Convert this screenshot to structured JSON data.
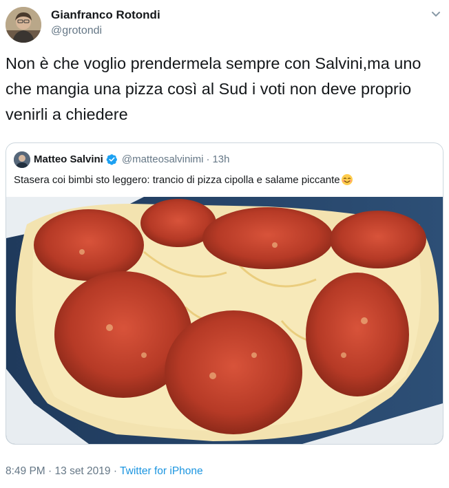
{
  "author": {
    "name": "Gianfranco Rotondi",
    "handle": "@grotondi"
  },
  "tweet": {
    "text": "Non è che voglio prendermela sempre con Salvini,ma uno che mangia una pizza così al Sud i voti non deve proprio venirli a chiedere"
  },
  "quoted": {
    "name": "Matteo Salvini",
    "handle": "@matteosalvinimi",
    "separator": "·",
    "time": "13h",
    "text": "Stasera coi bimbi sto leggero: trancio di pizza cipolla e salame piccante",
    "emoji": "smiling-face-icon",
    "image": "pizza-slice-with-salami-photo"
  },
  "footer": {
    "time": "8:49 PM",
    "separator1": " · ",
    "date": "13 set 2019",
    "separator2": " · ",
    "source": "Twitter for iPhone"
  },
  "colors": {
    "text": "#14171a",
    "secondary": "#657786",
    "link": "#1b95e0",
    "verified": "#1da1f2",
    "border": "#ccd6dd"
  },
  "icons": [
    "chevron-down-icon",
    "verified-badge-icon",
    "smiling-face-icon"
  ]
}
